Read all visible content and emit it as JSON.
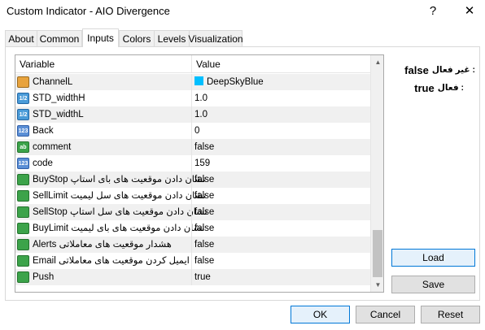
{
  "window": {
    "title": "Custom Indicator - AIO Divergence",
    "help_glyph": "?",
    "close_glyph": "✕"
  },
  "tabs": [
    {
      "label": "About"
    },
    {
      "label": "Common"
    },
    {
      "label": "Inputs"
    },
    {
      "label": "Colors"
    },
    {
      "label": "Levels"
    },
    {
      "label": "Visualization"
    }
  ],
  "active_tab": "Inputs",
  "grid": {
    "headers": {
      "variable": "Variable",
      "value": "Value"
    },
    "rows": [
      {
        "icon": "color-icon",
        "icon_text": "",
        "name": "ChannelL",
        "value": "DeepSkyBlue",
        "swatch": "#00bfff"
      },
      {
        "icon": "double-icon",
        "icon_text": "1/2",
        "name": "STD_widthH",
        "value": "1.0"
      },
      {
        "icon": "double-icon",
        "icon_text": "1/2",
        "name": "STD_widthL",
        "value": "1.0"
      },
      {
        "icon": "integer-icon",
        "icon_text": "123",
        "name": "Back",
        "value": "0"
      },
      {
        "icon": "string-icon",
        "icon_text": "ab",
        "name": "comment",
        "value": "false"
      },
      {
        "icon": "integer-icon",
        "icon_text": "123",
        "name": "code",
        "value": "159"
      },
      {
        "icon": "bool-icon",
        "icon_text": "",
        "name": "BuyStop  نشان دادن موقعیت های بای استاپ",
        "value": "false"
      },
      {
        "icon": "bool-icon",
        "icon_text": "",
        "name": "SellLimit  نشان دادن موقعیت های سل لیمیت",
        "value": "false"
      },
      {
        "icon": "bool-icon",
        "icon_text": "",
        "name": "SellStop  نشان دادن موقعیت های سل استاپ",
        "value": "false"
      },
      {
        "icon": "bool-icon",
        "icon_text": "",
        "name": "BuyLimit  نشان دادن موقعیت های بای لیمیت",
        "value": "false"
      },
      {
        "icon": "bool-icon",
        "icon_text": "",
        "name": "Alerts          هشدار موقعیت های معاملاتی",
        "value": "false"
      },
      {
        "icon": "bool-icon",
        "icon_text": "",
        "name": "Email      ایمیل کردن موقعیت های معاملاتی",
        "value": "false"
      },
      {
        "icon": "bool-icon",
        "icon_text": "",
        "name": "Push",
        "value": "true"
      }
    ]
  },
  "legend": [
    {
      "keyword": "false",
      "text": ": غیر فعال"
    },
    {
      "keyword": "true",
      "text": ": فعال"
    }
  ],
  "buttons": {
    "load": "Load",
    "save": "Save",
    "ok": "OK",
    "cancel": "Cancel",
    "reset": "Reset"
  },
  "colors": {
    "accent": "#0078d7",
    "row_alt": "#f0f0f0",
    "swatch_deepskyblue": "#00bfff"
  }
}
